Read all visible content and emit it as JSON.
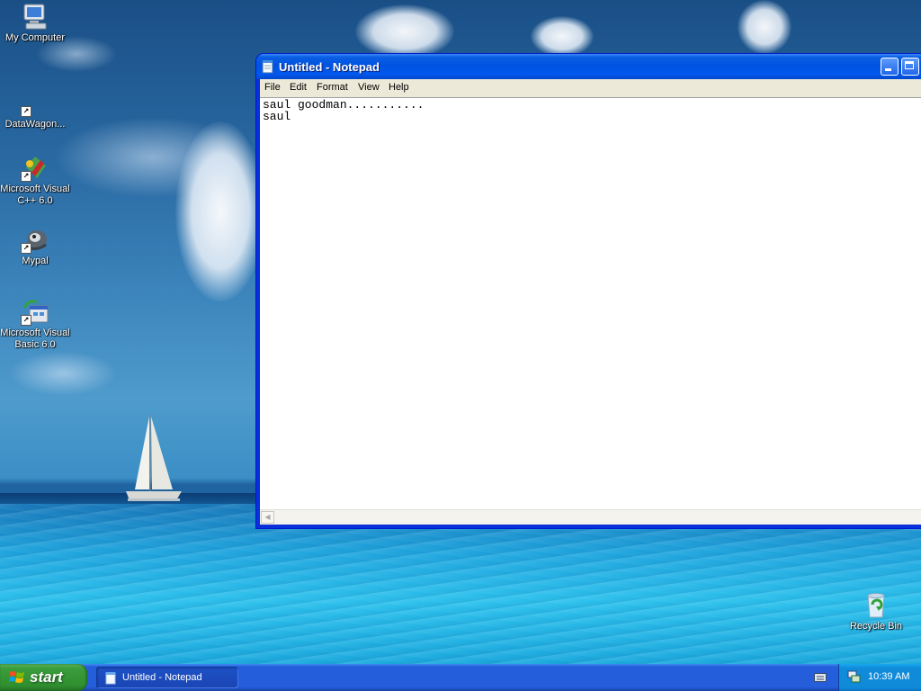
{
  "desktop": {
    "icons": [
      {
        "label": "My Computer",
        "icon": "my-computer-icon"
      },
      {
        "label": "DataWagon...",
        "icon": "datawagon-icon"
      },
      {
        "label": "Microsoft Visual C++ 6.0",
        "icon": "visual-cpp-icon"
      },
      {
        "label": "Mypal",
        "icon": "mypal-icon"
      },
      {
        "label": "Microsoft Visual Basic 6.0",
        "icon": "visual-basic-icon"
      },
      {
        "label": "Recycle Bin",
        "icon": "recycle-bin-icon"
      }
    ]
  },
  "window": {
    "title": "Untitled - Notepad",
    "menu": [
      "File",
      "Edit",
      "Format",
      "View",
      "Help"
    ],
    "text_lines": [
      "saul goodman...........",
      "saul"
    ]
  },
  "taskbar": {
    "start_label": "start",
    "task_label": "Untitled - Notepad",
    "clock": "10:39 AM"
  },
  "colors": {
    "titlebar": "#0054e3",
    "taskbar": "#245edb",
    "start": "#3c9d3c",
    "tray": "#0f8bda"
  }
}
